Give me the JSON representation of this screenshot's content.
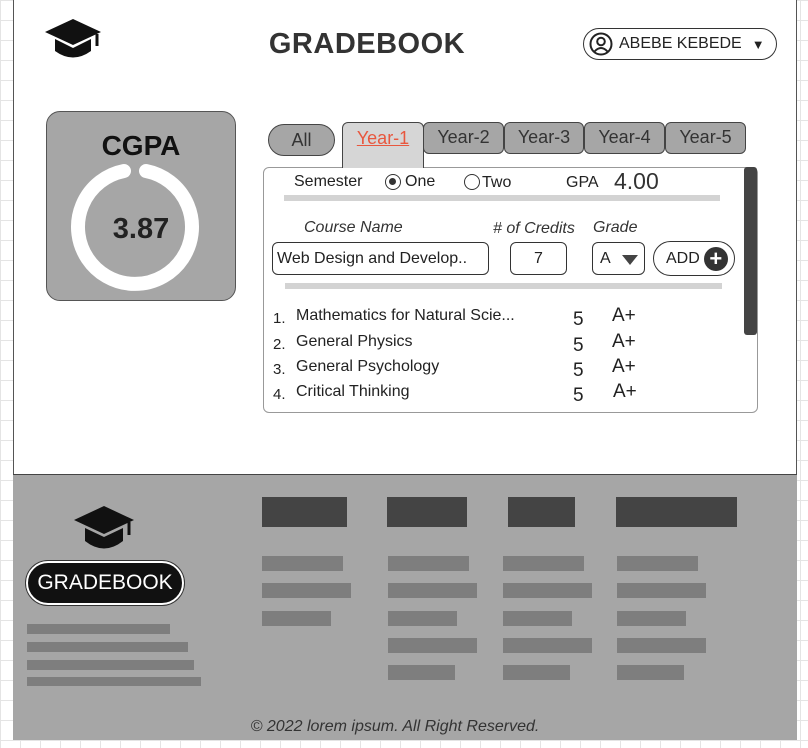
{
  "header": {
    "app_title": "GRADEBOOK",
    "user_name": "ABEBE KEBEDE",
    "logo_icon": "graduation-cap-icon",
    "user_icon": "user-circle-icon"
  },
  "cgpa": {
    "label": "CGPA",
    "value": "3.87"
  },
  "tabs": {
    "all": "All",
    "years": [
      "Year-1",
      "Year-2",
      "Year-3",
      "Year-4",
      "Year-5"
    ],
    "active": "Year-1"
  },
  "semester": {
    "label": "Semester",
    "options": [
      "One",
      "Two"
    ],
    "selected": "One",
    "gpa_label": "GPA",
    "gpa_value": "4.00"
  },
  "course_form": {
    "name_header": "Course Name",
    "credits_header": "# of Credits",
    "grade_header": "Grade",
    "name_value": "Web Design and Develop..",
    "credits_value": "7",
    "grade_value": "A",
    "add_label": "ADD"
  },
  "courses": [
    {
      "index": "1.",
      "name": "Mathematics for Natural Scie...",
      "credits": "5",
      "grade": "A+"
    },
    {
      "index": "2.",
      "name": "General Physics",
      "credits": "5",
      "grade": "A+"
    },
    {
      "index": "3.",
      "name": "General Psychology",
      "credits": "5",
      "grade": "A+"
    },
    {
      "index": "4.",
      "name": "Critical Thinking",
      "credits": "5",
      "grade": "A+"
    }
  ],
  "footer": {
    "brand": "GRADEBOOK",
    "copyright": "© 2022 lorem ipsum. All Right Reserved."
  },
  "colors": {
    "active_tab_text": "#e8573e",
    "card_gray": "#a6a6a6",
    "dark": "#444444"
  }
}
